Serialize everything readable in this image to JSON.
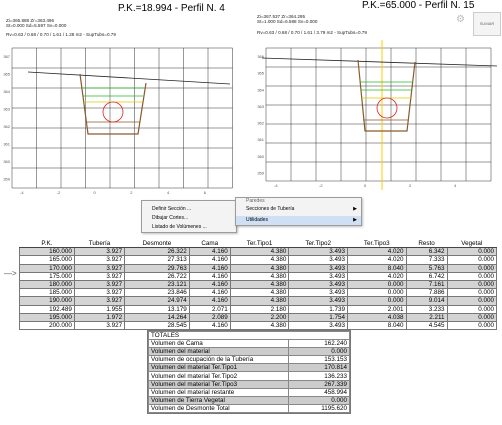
{
  "profiles": [
    {
      "title": "P.K.=18.994 - Perfil N. 4",
      "stats_line1": "Zi=365.888 Zr=363.496",
      "stats_line2": "St=0.000 Sd=5.597 Sv=0.000",
      "stats_line3": "Rv=0.63 / 0.68 / 0.70 / 1.61 / 1.28 m2 - SupTubs=0.79",
      "y_ticks": [
        "387",
        "365",
        "364",
        "363",
        "362",
        "361",
        "360",
        "359"
      ],
      "x_ticks": [
        "-4",
        "-2",
        "0",
        "2",
        "4",
        "6"
      ]
    },
    {
      "title": "P.K.=65.000 - Perfil N. 15",
      "stats_line1": "Zi=367.537 Zr=364.295",
      "stats_line2": "St=1.000 Sd=6.588 Sv=0.000",
      "stats_line3": "Rv=0.63 / 0.68 / 0.70 / 1.61 / 3.79 m2 - SupTubs=0.79",
      "y_ticks": [
        "366",
        "365",
        "364",
        "363",
        "362",
        "361",
        "360",
        "359"
      ],
      "x_ticks": [
        "-4",
        "-2",
        "0",
        "2",
        "4"
      ]
    }
  ],
  "right_tab_label": "SUMAR",
  "context_menu": {
    "items": [
      "Definir Sección ...",
      "Dibujar Cortes...",
      "Listado de Volúmenes ..."
    ]
  },
  "submenu": {
    "items": [
      {
        "label": "Paredes",
        "has_arrow": false
      },
      {
        "label": "Secciones de Tubería",
        "has_arrow": true
      },
      {
        "label": "Utilidades",
        "has_arrow": true
      }
    ]
  },
  "volumes_table": {
    "headers": [
      "P.K.",
      "Tubería",
      "Desmonte",
      "Cama",
      "Ter.Tipo1",
      "Ter.Tipo2",
      "Ter.Tipo3",
      "Resto",
      "Vegetal"
    ],
    "rows": [
      [
        "160.000",
        "3.927",
        "26.322",
        "4.160",
        "4.380",
        "3.493",
        "4.020",
        "6.342",
        "0.000"
      ],
      [
        "165.000",
        "3.927",
        "27.313",
        "4.160",
        "4.380",
        "3.493",
        "4.020",
        "7.333",
        "0.000"
      ],
      [
        "170.000",
        "3.927",
        "29.763",
        "4.160",
        "4.380",
        "3.493",
        "8.040",
        "5.763",
        "0.000"
      ],
      [
        "175.000",
        "3.927",
        "26.722",
        "4.160",
        "4.380",
        "3.493",
        "4.020",
        "6.742",
        "0.000"
      ],
      [
        "180.000",
        "3.927",
        "23.121",
        "4.160",
        "4.380",
        "3.493",
        "0.000",
        "7.161",
        "0.000"
      ],
      [
        "185.000",
        "3.927",
        "23.846",
        "4.160",
        "4.380",
        "3.493",
        "0.000",
        "7.886",
        "0.000"
      ],
      [
        "190.000",
        "3.927",
        "24.974",
        "4.160",
        "4.380",
        "3.493",
        "0.000",
        "9.014",
        "0.000"
      ],
      [
        "192.489",
        "1.955",
        "13.179",
        "2.071",
        "2.180",
        "1.739",
        "2.001",
        "3.233",
        "0.000"
      ],
      [
        "195.000",
        "1.972",
        "14.264",
        "2.089",
        "2.200",
        "1.754",
        "4.038",
        "2.211",
        "0.000"
      ],
      [
        "200.000",
        "3.927",
        "28.545",
        "4.160",
        "4.380",
        "3.493",
        "8.040",
        "4.545",
        "0.000"
      ]
    ]
  },
  "totals": {
    "title": "TOTALES",
    "rows": [
      {
        "label": "Volumen de Cama",
        "value": "162.240"
      },
      {
        "label": "Volumen del material",
        "value": "0.000"
      },
      {
        "label": "Volumen de ocupación de la Tubería",
        "value": "153.153"
      },
      {
        "label": "Volumen del material Ter.Tipo1",
        "value": "170.814"
      },
      {
        "label": "Volumen del material Ter.Tipo2",
        "value": "136.233"
      },
      {
        "label": "Volumen del material Ter.Tipo3",
        "value": "267.339"
      },
      {
        "label": "Volumen del material restante",
        "value": "458.994"
      },
      {
        "label": "Volumen de Tierra Vegetal",
        "value": "0.000"
      },
      {
        "label": "Volumen de Desmonte Total",
        "value": "1195.620"
      }
    ]
  },
  "colors": {
    "terrain": "#222222",
    "trench": "#8a5a2b",
    "fill_line_1": "#22bb22",
    "fill_line_2": "#ddcc00",
    "pipe": "#dd2222",
    "cursor": "#ffcc00",
    "grid": "#333333"
  }
}
